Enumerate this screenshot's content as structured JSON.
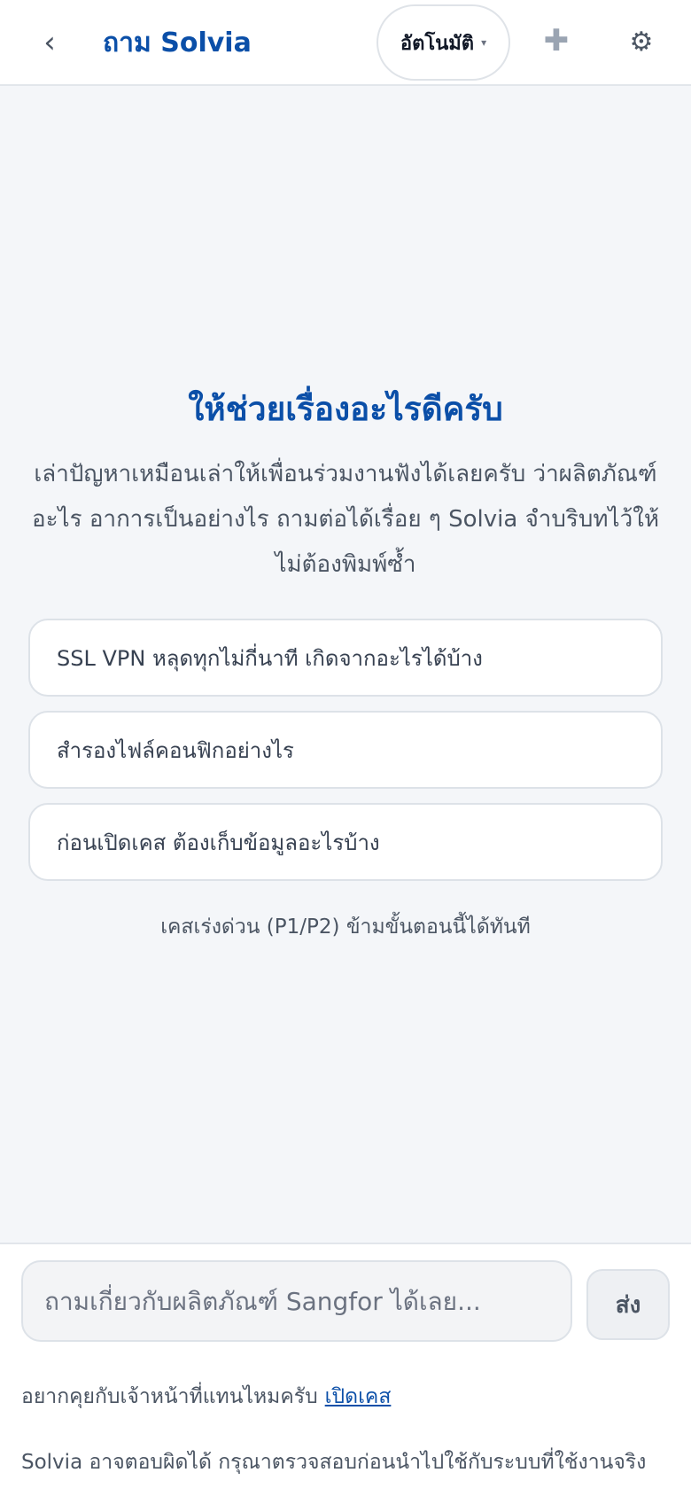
{
  "header": {
    "back_icon": "‹",
    "title": "ถาม Solvia",
    "mode_selected": "อัตโนมัติ",
    "mode_caret": "▾",
    "new_chat_icon": "✚",
    "settings_icon": "⚙"
  },
  "welcome": {
    "title": "ให้ช่วยเรื่องอะไรดีครับ",
    "description": "เล่าปัญหาเหมือนเล่าให้เพื่อนร่วมงานฟังได้เลยครับ ว่าผลิตภัณฑ์อะไร อาการเป็นอย่างไร ถามต่อได้เรื่อย ๆ Solvia จำบริบทไว้ให้ ไม่ต้องพิมพ์ซ้ำ"
  },
  "suggestions": [
    "SSL VPN หลุดทุกไม่กี่นาที เกิดจากอะไรได้บ้าง",
    "สำรองไฟล์คอนฟิกอย่างไร",
    "ก่อนเปิดเคส ต้องเก็บข้อมูลอะไรบ้าง"
  ],
  "urgent_note": "เคสเร่งด่วน (P1/P2) ข้ามขั้นตอนนี้ได้ทันที",
  "composer": {
    "placeholder": "ถามเกี่ยวกับผลิตภัณฑ์ Sangfor ได้เลย...",
    "send_label": "ส่ง",
    "handoff_text": "อยากคุยกับเจ้าหน้าที่แทนไหมครับ",
    "handoff_link": "เปิดเคส",
    "disclaimer": "Solvia อาจตอบผิดได้ กรุณาตรวจสอบก่อนนำไปใช้กับระบบที่ใช้งานจริง"
  },
  "colors": {
    "brand": "#0b4fa8",
    "background": "#f4f6f9",
    "surface": "#ffffff",
    "border": "#dde2e8",
    "muted_text": "#4b5563"
  }
}
